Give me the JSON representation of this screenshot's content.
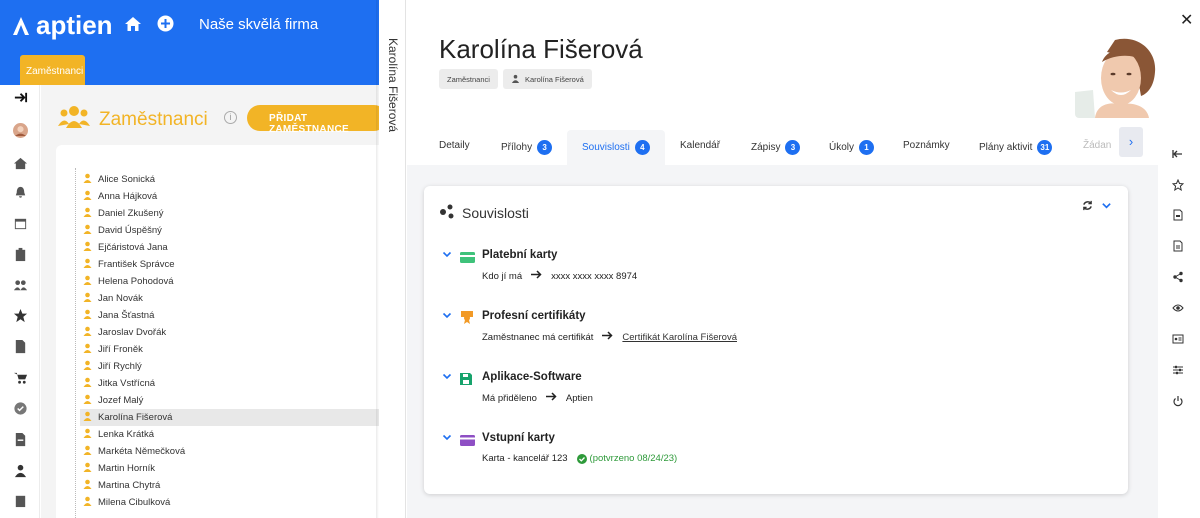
{
  "app": {
    "logo": "aptien",
    "company": "Naše skvělá firma",
    "module_tab": "Zaměstnanci"
  },
  "section": {
    "title": "Zaměstnanci",
    "info": "i",
    "add_button": "PŘIDAT ZAMĚSTNANCE"
  },
  "employees": [
    "Alice Sonická",
    "Anna Hájková",
    "Daniel Zkušený",
    "David Úspěšný",
    "Ejčáristová Jana",
    "František Správce",
    "Helena Pohodová",
    "Jan Novák",
    "Jana Šťastná",
    "Jaroslav Dvořák",
    "Jiří Froněk",
    "Jiří Rychlý",
    "Jitka Vstřícná",
    "Jozef Malý",
    "Karolína Fišerová",
    "Lenka Krátká",
    "Markéta Němečková",
    "Martin Horník",
    "Martina Chytrá",
    "Milena Cibulková"
  ],
  "selected_employee": "Karolína Fišerová",
  "drawer": {
    "vertical_title": "Karolína Fišerová",
    "name": "Karolína Fišerová",
    "breadcrumb": [
      "Zaměstnanci",
      "Karolína Fišerová"
    ],
    "tabs": [
      {
        "label": "Detaily",
        "badge": ""
      },
      {
        "label": "Přílohy",
        "badge": "3"
      },
      {
        "label": "Souvislosti",
        "badge": "4"
      },
      {
        "label": "Kalendář",
        "badge": ""
      },
      {
        "label": "Zápisy",
        "badge": "3"
      },
      {
        "label": "Úkoly",
        "badge": "1"
      },
      {
        "label": "Poznámky",
        "badge": ""
      },
      {
        "label": "Plány aktivit",
        "badge": "31"
      },
      {
        "label": "Žádan",
        "badge": ""
      }
    ],
    "active_tab": "Souvislosti",
    "card": {
      "title": "Souvislosti",
      "relations": [
        {
          "title": "Platební karty",
          "label": "Kdo jí má",
          "value": "xxxx xxxx xxxx 8974",
          "icon": "card-icon",
          "color": "#3ec27a"
        },
        {
          "title": "Profesní certifikáty",
          "label": "Zaměstnanec má certifikát",
          "value": "Certifikát Karolína Fišerová",
          "icon": "certificate-icon",
          "color": "#f29a26"
        },
        {
          "title": "Aplikace-Software",
          "label": "Má přiděleno",
          "value": "Aptien",
          "icon": "save-icon",
          "color": "#17a36c"
        },
        {
          "title": "Vstupní karty",
          "label": "Karta - kancelář 123",
          "value": "(potvrzeno 08/24/23)",
          "icon": "access-card-icon",
          "color": "#8e4fc4"
        }
      ]
    }
  },
  "colors": {
    "primary": "#1e6ff1",
    "accent": "#f2b426",
    "success": "#2e9a3a"
  }
}
